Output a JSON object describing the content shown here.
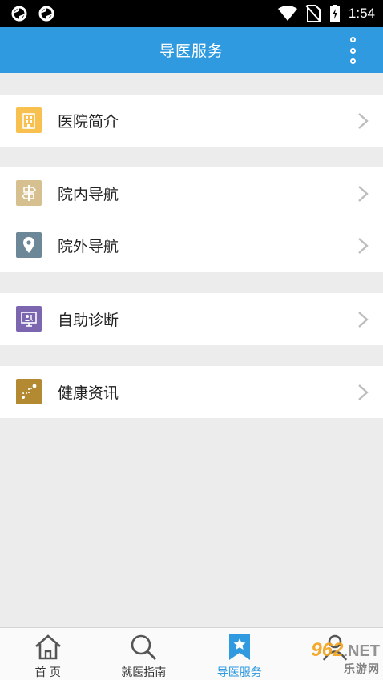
{
  "status_bar": {
    "time": "1:54",
    "icons": [
      "sync-icon",
      "sync-icon",
      "wifi-icon",
      "no-sim-icon",
      "battery-charging-icon"
    ]
  },
  "app_bar": {
    "title": "导医服务",
    "overflow_icon": "more-vertical-icon"
  },
  "menu": {
    "groups": [
      {
        "items": [
          {
            "label": "医院简介",
            "icon": "hospital-building-icon",
            "color": "#f7c04f"
          }
        ]
      },
      {
        "items": [
          {
            "label": "院内导航",
            "icon": "signpost-icon",
            "color": "#d6c08f"
          },
          {
            "label": "院外导航",
            "icon": "location-pin-icon",
            "color": "#6b8798"
          }
        ]
      },
      {
        "items": [
          {
            "label": "自助诊断",
            "icon": "monitor-doctor-icon",
            "color": "#7d66b0"
          }
        ]
      },
      {
        "items": [
          {
            "label": "健康资讯",
            "icon": "route-icon",
            "color": "#b38a32"
          }
        ]
      }
    ],
    "chevron_icon": "chevron-right-icon"
  },
  "bottom_nav": {
    "items": [
      {
        "label": "首 页",
        "icon": "home-icon",
        "active": false
      },
      {
        "label": "就医指南",
        "icon": "search-icon",
        "active": false
      },
      {
        "label": "导医服务",
        "icon": "bookmark-star-icon",
        "active": true
      },
      {
        "label": "",
        "icon": "person-icon",
        "active": false
      }
    ]
  },
  "watermark": {
    "top_digits": "962",
    "top_suffix": ".NET",
    "bottom": "乐游网"
  },
  "colors": {
    "accent": "#2f9ae0",
    "background": "#ececec",
    "divider": "#d4d4d4"
  }
}
